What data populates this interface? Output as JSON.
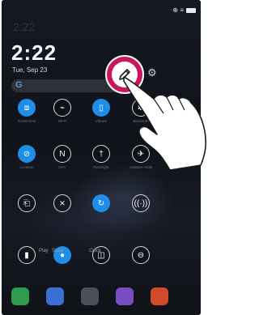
{
  "status": {
    "icons": "⊕ ≡"
  },
  "home": {
    "ghost_time": "2:22",
    "time": "2:22",
    "date": "Tue, Sep 23",
    "search_icon": "G"
  },
  "edit_button": {
    "icon": "pencil-icon"
  },
  "settings": {
    "icon": "gear-icon",
    "glyph": "⚙"
  },
  "quick_tiles": [
    {
      "icon": "screen-capture-icon",
      "glyph": "⧈",
      "state": "on",
      "label": "Screenshot"
    },
    {
      "icon": "wifi-icon",
      "glyph": "⌁",
      "state": "off",
      "label": "Wi-Fi"
    },
    {
      "icon": "vibrate-icon",
      "glyph": "▯",
      "state": "on",
      "label": "Vibrate"
    },
    {
      "icon": "bluetooth-icon",
      "glyph": "✱",
      "state": "off",
      "label": "Bluetooth"
    },
    {
      "icon": "location-icon",
      "glyph": "⊘",
      "state": "on",
      "label": "Location"
    },
    {
      "icon": "nfc-icon",
      "glyph": "N",
      "state": "off",
      "label": "NFC"
    },
    {
      "icon": "flashlight-icon",
      "glyph": "†",
      "state": "off",
      "label": "Flashlight"
    },
    {
      "icon": "airplane-icon",
      "glyph": "✈",
      "state": "off",
      "label": "Airplane mode"
    },
    {
      "icon": "screen-mirror-icon",
      "glyph": "⎗",
      "state": "off",
      "label": ""
    },
    {
      "icon": "sound-off-icon",
      "glyph": "⨯",
      "state": "off",
      "label": ""
    },
    {
      "icon": "sync-icon",
      "glyph": "↻",
      "state": "on",
      "label": ""
    },
    {
      "icon": "hotspot-icon",
      "glyph": "((·))",
      "state": "off",
      "label": ""
    },
    {
      "icon": "battery-saver-icon",
      "glyph": "▮",
      "state": "off",
      "label": ""
    },
    {
      "icon": "location-pin-icon",
      "glyph": "●",
      "state": "on",
      "label": ""
    },
    {
      "icon": "dual-window-icon",
      "glyph": "◫",
      "state": "off",
      "label": ""
    },
    {
      "icon": "do-not-disturb-icon",
      "glyph": "⊖",
      "state": "off",
      "label": ""
    }
  ],
  "middle_labels": [
    "Play",
    "Store",
    "Clock"
  ],
  "dock_apps": [
    {
      "name": "phone-app",
      "color": "#2e9c4a"
    },
    {
      "name": "messages-app",
      "color": "#3b6fd4"
    },
    {
      "name": "camera-app",
      "color": "#4a4f5a"
    },
    {
      "name": "gallery-app",
      "color": "#7a4cc2"
    },
    {
      "name": "browser-app",
      "color": "#d24a2a"
    }
  ]
}
